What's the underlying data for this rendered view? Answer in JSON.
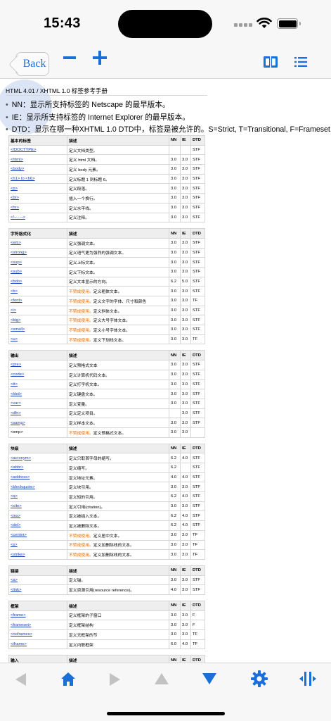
{
  "status_bar": {
    "time": "15:43"
  },
  "toolbar": {
    "back_label": "Back",
    "zoom_out": "zoom-out-icon",
    "zoom_in": "zoom-in-icon",
    "book": "book-icon",
    "list": "list-icon",
    "accent": "#1a6fd8"
  },
  "doc": {
    "title": "HTML 4.01 / XHTML 1.0 标签参考手册",
    "bullets": [
      "NN：显示所支持标签的 Netscape 的最早版本。",
      "IE：显示所支持标签的 Internet Explorer 的最早版本。",
      "DTD：显示在哪一种XHTML 1.0 DTD中，标签是被允许的。S=Strict, T=Transitional, F=Frameset."
    ]
  },
  "tables": [
    {
      "headers": [
        "基本的标签",
        "描述",
        "NN",
        "IE",
        "DTD"
      ],
      "rows": [
        {
          "tag": "<!DOCTYPE>",
          "warn": "",
          "desc": "定义文档类型。",
          "nn": "",
          "ie": "",
          "dtd": "STF"
        },
        {
          "tag": "<html>",
          "warn": "",
          "desc": "定义 html 文档。",
          "nn": "3.0",
          "ie": "3.0",
          "dtd": "STF"
        },
        {
          "tag": "<body>",
          "warn": "",
          "desc": "定义 body 元素。",
          "nn": "3.0",
          "ie": "3.0",
          "dtd": "STF"
        },
        {
          "tag": "<h1> to <h6>",
          "warn": "",
          "desc": "定义标题 1 到标题 6。",
          "nn": "3.0",
          "ie": "3.0",
          "dtd": "STF"
        },
        {
          "tag": "<p>",
          "warn": "",
          "desc": "定义段落。",
          "nn": "3.0",
          "ie": "3.0",
          "dtd": "STF"
        },
        {
          "tag": "<br>",
          "warn": "",
          "desc": "插入一个换行。",
          "nn": "3.0",
          "ie": "3.0",
          "dtd": "STF"
        },
        {
          "tag": "<hr>",
          "warn": "",
          "desc": "定义水平线。",
          "nn": "3.0",
          "ie": "3.0",
          "dtd": "STF"
        },
        {
          "tag": "<!--...-->",
          "warn": "",
          "desc": "定义注释。",
          "nn": "3.0",
          "ie": "3.0",
          "dtd": "STF"
        }
      ]
    },
    {
      "headers": [
        "字符格式化",
        "描述",
        "NN",
        "IE",
        "DTD"
      ],
      "rows": [
        {
          "tag": "<em>",
          "warn": "",
          "desc": "定义强调文本。",
          "nn": "3.0",
          "ie": "3.0",
          "dtd": "STF"
        },
        {
          "tag": "<strong>",
          "warn": "",
          "desc": "定义语气更为强烈的强调文本。",
          "nn": "3.0",
          "ie": "3.0",
          "dtd": "STF"
        },
        {
          "tag": "<sup>",
          "warn": "",
          "desc": "定义上标文本。",
          "nn": "3.0",
          "ie": "3.0",
          "dtd": "STF"
        },
        {
          "tag": "<sub>",
          "warn": "",
          "desc": "定义下标文本。",
          "nn": "3.0",
          "ie": "3.0",
          "dtd": "STF"
        },
        {
          "tag": "<bdo>",
          "warn": "",
          "desc": "定义文本显示的方向。",
          "nn": "6.2",
          "ie": "5.0",
          "dtd": "STF"
        },
        {
          "tag": "<b>",
          "warn": "不赞成使用。",
          "desc": "定义粗体文本。",
          "nn": "3.0",
          "ie": "3.0",
          "dtd": "STF"
        },
        {
          "tag": "<font>",
          "warn": "不赞成使用。",
          "desc": "定义文字的字体、尺寸和颜色",
          "nn": "3.0",
          "ie": "3.0",
          "dtd": "TF"
        },
        {
          "tag": "<i>",
          "warn": "不赞成使用。",
          "desc": "定义斜体文本。",
          "nn": "3.0",
          "ie": "3.0",
          "dtd": "STF"
        },
        {
          "tag": "<big>",
          "warn": "不赞成使用。",
          "desc": "定义大号字体文本。",
          "nn": "3.0",
          "ie": "3.0",
          "dtd": "STF"
        },
        {
          "tag": "<small>",
          "warn": "不赞成使用。",
          "desc": "定义小号字体文本。",
          "nn": "3.0",
          "ie": "3.0",
          "dtd": "STF"
        },
        {
          "tag": "<u>",
          "warn": "不赞成使用。",
          "desc": "定义下划线文本。",
          "nn": "3.0",
          "ie": "3.0",
          "dtd": "TF"
        }
      ]
    },
    {
      "headers": [
        "输出",
        "描述",
        "NN",
        "IE",
        "DTD"
      ],
      "rows": [
        {
          "tag": "<pre>",
          "warn": "",
          "desc": "定义预格式文本",
          "nn": "3.0",
          "ie": "3.0",
          "dtd": "STF"
        },
        {
          "tag": "<code>",
          "warn": "",
          "desc": "定义计算机代码文本。",
          "nn": "3.0",
          "ie": "3.0",
          "dtd": "STF"
        },
        {
          "tag": "<tt>",
          "warn": "",
          "desc": "定义打字机文本。",
          "nn": "3.0",
          "ie": "3.0",
          "dtd": "STF"
        },
        {
          "tag": "<kbd>",
          "warn": "",
          "desc": "定义键盘文本。",
          "nn": "3.0",
          "ie": "3.0",
          "dtd": "STF"
        },
        {
          "tag": "<var>",
          "warn": "",
          "desc": "定义变量。",
          "nn": "3.0",
          "ie": "3.0",
          "dtd": "STF"
        },
        {
          "tag": "<dfn>",
          "warn": "",
          "desc": "定义定义项目。",
          "nn": "",
          "ie": "3.0",
          "dtd": "STF"
        },
        {
          "tag": "<samp>",
          "warn": "",
          "desc": "定义样本文本。",
          "nn": "3.0",
          "ie": "3.0",
          "dtd": "STF"
        },
        {
          "tag": "<xmp>",
          "warn": "不赞成使用。",
          "desc": "定义预格式文本。",
          "nn": "3.0",
          "ie": "3.0",
          "dtd": "",
          "plain": true
        }
      ]
    },
    {
      "headers": [
        "块级",
        "描述",
        "NN",
        "IE",
        "DTD"
      ],
      "rows": [
        {
          "tag": "<acronym>",
          "warn": "",
          "desc": "定义只取首字母的缩写。",
          "nn": "6.2",
          "ie": "4.0",
          "dtd": "STF"
        },
        {
          "tag": "<abbr>",
          "warn": "",
          "desc": "定义缩写。",
          "nn": "6.2",
          "ie": "",
          "dtd": "STF"
        },
        {
          "tag": "<address>",
          "warn": "",
          "desc": "定义地址元素。",
          "nn": "4.0",
          "ie": "4.0",
          "dtd": "STF"
        },
        {
          "tag": "<blockquote>",
          "warn": "",
          "desc": "定义块引用。",
          "nn": "3.0",
          "ie": "3.0",
          "dtd": "STF"
        },
        {
          "tag": "<q>",
          "warn": "",
          "desc": "定义短的引用。",
          "nn": "6.2",
          "ie": "4.0",
          "dtd": "STF"
        },
        {
          "tag": "<cite>",
          "warn": "",
          "desc": "定义引用(citation)。",
          "nn": "3.0",
          "ie": "3.0",
          "dtd": "STF"
        },
        {
          "tag": "<ins>",
          "warn": "",
          "desc": "定义被插入文本。",
          "nn": "6.2",
          "ie": "4.0",
          "dtd": "STF"
        },
        {
          "tag": "<del>",
          "warn": "",
          "desc": "定义被删除文本。",
          "nn": "6.2",
          "ie": "4.0",
          "dtd": "STF"
        },
        {
          "tag": "<center>",
          "warn": "不赞成使用。",
          "desc": "定义居中文本。",
          "nn": "3.0",
          "ie": "3.0",
          "dtd": "TF"
        },
        {
          "tag": "<s>",
          "warn": "不赞成使用。",
          "desc": "定义加删除线的文本。",
          "nn": "3.0",
          "ie": "3.0",
          "dtd": "TF"
        },
        {
          "tag": "<strike>",
          "warn": "不赞成使用。",
          "desc": "定义加删除线的文本。",
          "nn": "3.0",
          "ie": "3.0",
          "dtd": "TF"
        }
      ]
    },
    {
      "headers": [
        "链接",
        "描述",
        "NN",
        "IE",
        "DTD"
      ],
      "rows": [
        {
          "tag": "<a>",
          "warn": "",
          "desc": "定义锚。",
          "nn": "3.0",
          "ie": "3.0",
          "dtd": "STF"
        },
        {
          "tag": "<link>",
          "warn": "",
          "desc": "定义资源引用(resource reference)。",
          "nn": "4.0",
          "ie": "3.0",
          "dtd": "STF"
        }
      ]
    },
    {
      "headers": [
        "框架",
        "描述",
        "NN",
        "IE",
        "DTD"
      ],
      "rows": [
        {
          "tag": "<frame>",
          "warn": "",
          "desc": "定义框架的子窗口",
          "nn": "3.0",
          "ie": "3.0",
          "dtd": "F"
        },
        {
          "tag": "<frameset>",
          "warn": "",
          "desc": "定义框架结构",
          "nn": "3.0",
          "ie": "3.0",
          "dtd": "F"
        },
        {
          "tag": "<noframes>",
          "warn": "",
          "desc": "定义无框架的节",
          "nn": "3.0",
          "ie": "3.0",
          "dtd": "TF"
        },
        {
          "tag": "<iframe>",
          "warn": "",
          "desc": "定义内联框架",
          "nn": "6.0",
          "ie": "4.0",
          "dtd": "TF"
        }
      ]
    },
    {
      "headers": [
        "输入",
        "描述",
        "NN",
        "IE",
        "DTD"
      ],
      "rows": [
        {
          "tag": "<form>",
          "warn": "",
          "desc": "定义表单。",
          "nn": "3.0",
          "ie": "3.0",
          "dtd": "STF"
        }
      ]
    }
  ],
  "bottom_bar": {
    "icons": [
      "back-arrow-icon",
      "home-icon",
      "forward-arrow-icon",
      "scroll-up-icon",
      "scroll-down-icon",
      "settings-gear-icon",
      "split-view-icon"
    ],
    "active_color": "#1a6fd8",
    "disabled_color": "#c2c2c2"
  }
}
